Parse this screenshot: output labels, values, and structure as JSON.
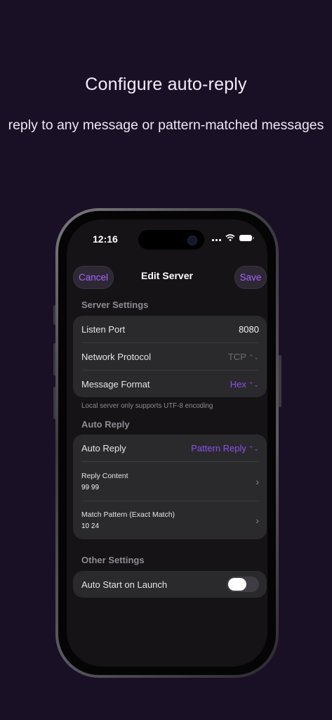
{
  "promo": {
    "headline": "Configure auto-reply",
    "subline": "reply to any message or pattern-matched messages"
  },
  "status_bar": {
    "time": "12:16"
  },
  "nav": {
    "cancel": "Cancel",
    "title": "Edit Server",
    "save": "Save"
  },
  "server_settings": {
    "header": "Server Settings",
    "listen_port": {
      "label": "Listen Port",
      "value": "8080"
    },
    "network_protocol": {
      "label": "Network Protocol",
      "value": "TCP"
    },
    "message_format": {
      "label": "Message Format",
      "value": "Hex"
    },
    "footnote": "Local server only supports UTF-8 encoding"
  },
  "auto_reply": {
    "header": "Auto Reply",
    "mode": {
      "label": "Auto Reply",
      "value": "Pattern Reply"
    },
    "reply_content": {
      "label": "Reply Content",
      "value": "99 99"
    },
    "match_pattern": {
      "label": "Match Pattern (Exact Match)",
      "value": "10 24"
    }
  },
  "other_settings": {
    "header": "Other Settings",
    "auto_start": {
      "label": "Auto Start on Launch",
      "enabled": false
    }
  },
  "colors": {
    "accent": "#9050ee",
    "background": "#1a1026"
  },
  "icons": [
    "chevron-right-icon",
    "up-down-chevron-icon",
    "wifi-icon",
    "signal-icon",
    "battery-icon"
  ]
}
